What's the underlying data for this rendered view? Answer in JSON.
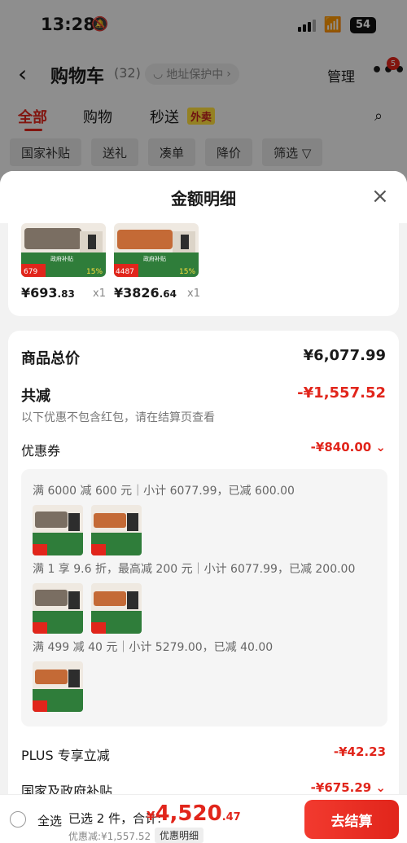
{
  "status_bar": {
    "time": "13:28",
    "battery": "54"
  },
  "nav": {
    "back": "‹",
    "title": "购物车",
    "count": "(32)",
    "address_protect": "地址保护中",
    "address_chevron": "›",
    "manage": "管理",
    "more_badge": "5"
  },
  "tabs": [
    {
      "label": "全部"
    },
    {
      "label": "购物"
    },
    {
      "label": "秒送"
    }
  ],
  "tab_badge": "外卖",
  "filters": [
    "国家补贴",
    "送礼",
    "凑单",
    "降价",
    "筛选 ▽"
  ],
  "sheet": {
    "title": "金额明细",
    "close": "×",
    "items": [
      {
        "price_int": "¥693",
        "price_dec": ".83",
        "qty": "x1",
        "tag": "679"
      },
      {
        "price_int": "¥3826",
        "price_dec": ".64",
        "qty": "x1",
        "tag": "4487"
      }
    ],
    "total_label": "商品总价",
    "total_value": "¥6,077.99",
    "reduce_label": "共减",
    "reduce_value": "-¥1,557.52",
    "reduce_note": "以下优惠不包含红包，请在结算页查看",
    "coupon_label": "优惠券",
    "coupon_value": "-¥840.00 ⌄",
    "rules": [
      "满 6000 减 600 元｜小计 6077.99，已减 600.00",
      "满 1 享 9.6 折，最高减 200 元｜小计 6077.99，已减 200.00",
      "满 499 减 40 元｜小计 5279.00，已减 40.00"
    ],
    "plus_label": "PLUS 专享立减",
    "plus_value": "-¥42.23",
    "gov_label": "国家及政府补贴",
    "gov_value": "-¥675.29 ⌄"
  },
  "bottom": {
    "select_all": "全选",
    "selected": "已选 2 件，合计:",
    "currency": "¥",
    "total_int": "4,520",
    "total_dec": ".47",
    "discount_note": "优惠减:¥1,557.52",
    "detail_link": "优惠明细",
    "checkout": "去结算"
  },
  "colors": {
    "accent": "#e1251b",
    "sofa_grey": "#7a6e62",
    "sofa_orange": "#c46a36",
    "promo_green": "#2f7d3a"
  }
}
